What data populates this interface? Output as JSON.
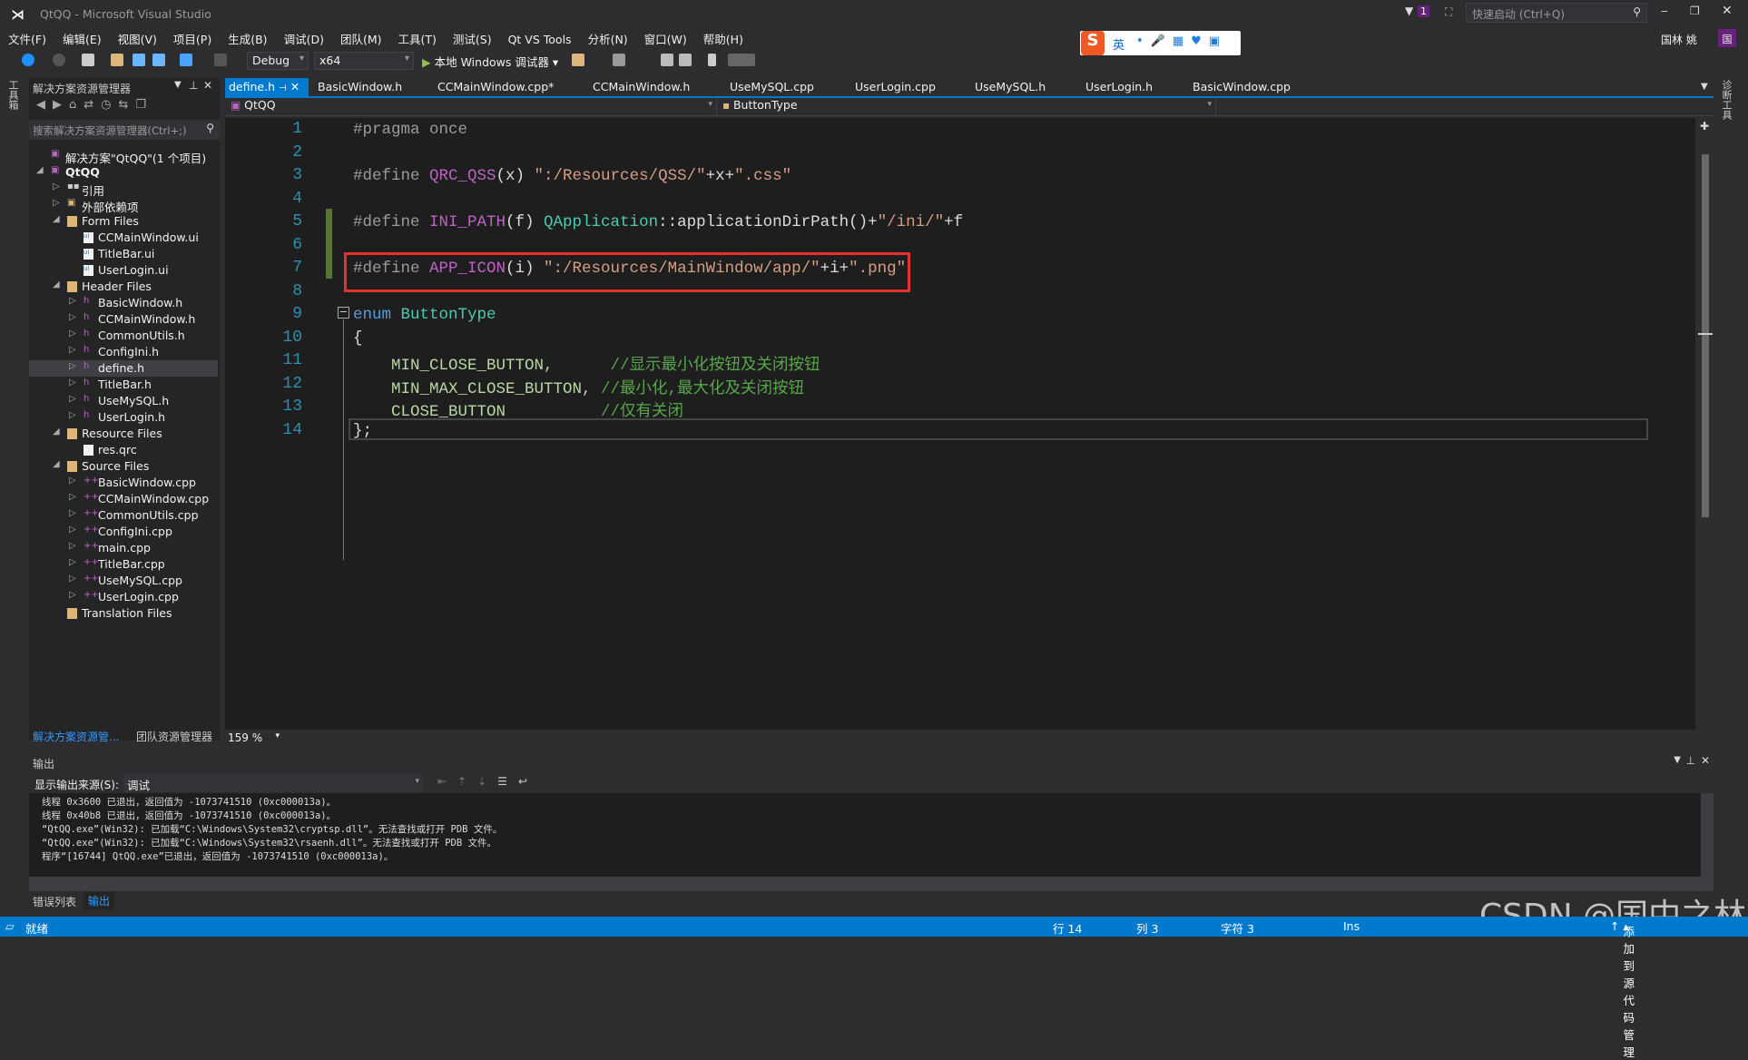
{
  "window": {
    "title": "QtQQ - Microsoft Visual Studio",
    "quick_launch_placeholder": "快速启动 (Ctrl+Q)",
    "notification_count": "1",
    "user_name": "国林 姚",
    "user_initial": "国"
  },
  "menu": [
    "文件(F)",
    "编辑(E)",
    "视图(V)",
    "项目(P)",
    "生成(B)",
    "调试(D)",
    "团队(M)",
    "工具(T)",
    "测试(S)",
    "Qt VS Tools",
    "分析(N)",
    "窗口(W)",
    "帮助(H)"
  ],
  "toolbar": {
    "configuration": "Debug",
    "platform": "x64",
    "debugger_label": "本地 Windows 调试器"
  },
  "ime": {
    "mode": "英"
  },
  "side_tabs": {
    "left": "工具箱",
    "right": "诊断工具"
  },
  "solution_explorer": {
    "title": "解决方案资源管理器",
    "search_placeholder": "搜索解决方案资源管理器(Ctrl+;)",
    "items": [
      {
        "label": "解决方案\"QtQQ\"(1 个项目)",
        "level": 0,
        "expander": "",
        "icon": "solution"
      },
      {
        "label": "QtQQ",
        "level": 0,
        "expander": "open",
        "icon": "project",
        "bold": true
      },
      {
        "label": "引用",
        "level": 1,
        "expander": "closed",
        "icon": "references"
      },
      {
        "label": "外部依赖项",
        "level": 1,
        "expander": "closed",
        "icon": "external"
      },
      {
        "label": "Form Files",
        "level": 1,
        "expander": "open",
        "icon": "folder"
      },
      {
        "label": "CCMainWindow.ui",
        "level": 2,
        "expander": "",
        "icon": "ui"
      },
      {
        "label": "TitleBar.ui",
        "level": 2,
        "expander": "",
        "icon": "ui"
      },
      {
        "label": "UserLogin.ui",
        "level": 2,
        "expander": "",
        "icon": "ui"
      },
      {
        "label": "Header Files",
        "level": 1,
        "expander": "open",
        "icon": "folder"
      },
      {
        "label": "BasicWindow.h",
        "level": 2,
        "expander": "closed",
        "icon": "h"
      },
      {
        "label": "CCMainWindow.h",
        "level": 2,
        "expander": "closed",
        "icon": "h"
      },
      {
        "label": "CommonUtils.h",
        "level": 2,
        "expander": "closed",
        "icon": "h"
      },
      {
        "label": "ConfigIni.h",
        "level": 2,
        "expander": "closed",
        "icon": "h"
      },
      {
        "label": "define.h",
        "level": 2,
        "expander": "closed",
        "icon": "h",
        "selected": true
      },
      {
        "label": "TitleBar.h",
        "level": 2,
        "expander": "closed",
        "icon": "h"
      },
      {
        "label": "UseMySQL.h",
        "level": 2,
        "expander": "closed",
        "icon": "h"
      },
      {
        "label": "UserLogin.h",
        "level": 2,
        "expander": "closed",
        "icon": "h"
      },
      {
        "label": "Resource Files",
        "level": 1,
        "expander": "open",
        "icon": "folder"
      },
      {
        "label": "res.qrc",
        "level": 2,
        "expander": "",
        "icon": "file"
      },
      {
        "label": "Source Files",
        "level": 1,
        "expander": "open",
        "icon": "folder"
      },
      {
        "label": "BasicWindow.cpp",
        "level": 2,
        "expander": "closed",
        "icon": "cpp"
      },
      {
        "label": "CCMainWindow.cpp",
        "level": 2,
        "expander": "closed",
        "icon": "cpp"
      },
      {
        "label": "CommonUtils.cpp",
        "level": 2,
        "expander": "closed",
        "icon": "cpp"
      },
      {
        "label": "ConfigIni.cpp",
        "level": 2,
        "expander": "closed",
        "icon": "cpp"
      },
      {
        "label": "main.cpp",
        "level": 2,
        "expander": "closed",
        "icon": "cpp"
      },
      {
        "label": "TitleBar.cpp",
        "level": 2,
        "expander": "closed",
        "icon": "cpp"
      },
      {
        "label": "UseMySQL.cpp",
        "level": 2,
        "expander": "closed",
        "icon": "cpp"
      },
      {
        "label": "UserLogin.cpp",
        "level": 2,
        "expander": "closed",
        "icon": "cpp"
      },
      {
        "label": "Translation Files",
        "level": 1,
        "expander": "",
        "icon": "folder"
      }
    ],
    "bottom_tabs": [
      "解决方案资源管...",
      "团队资源管理器"
    ]
  },
  "editor": {
    "tabs": [
      {
        "label": "define.h",
        "active": true
      },
      {
        "label": "BasicWindow.h"
      },
      {
        "label": "CCMainWindow.cpp*"
      },
      {
        "label": "CCMainWindow.h"
      },
      {
        "label": "UseMySQL.cpp"
      },
      {
        "label": "UserLogin.cpp"
      },
      {
        "label": "UseMySQL.h"
      },
      {
        "label": "UserLogin.h"
      },
      {
        "label": "BasicWindow.cpp"
      }
    ],
    "nav_project": "QtQQ",
    "nav_scope": "ButtonType",
    "zoom": "159 %",
    "highlighted_line": 7,
    "lines": [
      [
        {
          "t": "#pragma once",
          "c": "pre"
        }
      ],
      [],
      [
        {
          "t": "#define ",
          "c": "pre"
        },
        {
          "t": "QRC_QSS",
          "c": "macro"
        },
        {
          "t": "(x) ",
          "c": "plain"
        },
        {
          "t": "\":/Resources/QSS/\"",
          "c": "str"
        },
        {
          "t": "+x+",
          "c": "plain"
        },
        {
          "t": "\".css\"",
          "c": "str"
        }
      ],
      [],
      [
        {
          "t": "#define ",
          "c": "pre"
        },
        {
          "t": "INI_PATH",
          "c": "macro"
        },
        {
          "t": "(f) ",
          "c": "plain"
        },
        {
          "t": "QApplication",
          "c": "type"
        },
        {
          "t": "::applicationDirPath()+",
          "c": "plain"
        },
        {
          "t": "\"/ini/\"",
          "c": "str"
        },
        {
          "t": "+f",
          "c": "plain"
        }
      ],
      [],
      [
        {
          "t": "#define ",
          "c": "pre"
        },
        {
          "t": "APP_ICON",
          "c": "macro"
        },
        {
          "t": "(i) ",
          "c": "plain"
        },
        {
          "t": "\":/Resources/MainWindow/app/\"",
          "c": "str"
        },
        {
          "t": "+i+",
          "c": "plain"
        },
        {
          "t": "\".png\"",
          "c": "str"
        }
      ],
      [],
      [
        {
          "t": "enum ",
          "c": "kw"
        },
        {
          "t": "ButtonType",
          "c": "type"
        }
      ],
      [
        {
          "t": "{",
          "c": "plain"
        }
      ],
      [
        {
          "t": "    MIN_CLOSE_BUTTON,      ",
          "c": "enumv"
        },
        {
          "t": "//显示最小化按钮及关闭按钮",
          "c": "comment"
        }
      ],
      [
        {
          "t": "    MIN_MAX_CLOSE_BUTTON, ",
          "c": "enumv"
        },
        {
          "t": "//最小化,最大化及关闭按钮",
          "c": "comment"
        }
      ],
      [
        {
          "t": "    CLOSE_BUTTON          ",
          "c": "enumv"
        },
        {
          "t": "//仅有关闭",
          "c": "comment"
        }
      ],
      [
        {
          "t": "};",
          "c": "plain"
        }
      ]
    ]
  },
  "output": {
    "title": "输出",
    "source_label": "显示输出来源(S):",
    "source_value": "调试",
    "lines": [
      "线程 0x3600 已退出，返回值为 -1073741510 (0xc000013a)。",
      "线程 0x40b8 已退出，返回值为 -1073741510 (0xc000013a)。",
      "“QtQQ.exe”(Win32): 已加载“C:\\Windows\\System32\\cryptsp.dll”。无法查找或打开 PDB 文件。",
      "“QtQQ.exe”(Win32): 已加载“C:\\Windows\\System32\\rsaenh.dll”。无法查找或打开 PDB 文件。",
      "程序“[16744] QtQQ.exe”已退出，返回值为 -1073741510 (0xc000013a)。"
    ],
    "bottom_tabs": [
      {
        "label": "错误列表"
      },
      {
        "label": "输出",
        "active": true
      }
    ]
  },
  "status": {
    "ready": "就绪",
    "line": "行 14",
    "col": "列 3",
    "char": "字符 3",
    "mode": "Ins",
    "source_control": "添加到源代码管理"
  },
  "watermark": "CSDN @国中之林",
  "colors": {
    "accent": "#007acc",
    "highlight_box": "#e8312f",
    "line_numbers": "#2b91af",
    "macro": "#bd63c5",
    "string": "#d69d85",
    "type": "#4ec9b0",
    "comment": "#57a64a",
    "change_bar": "#577430"
  }
}
